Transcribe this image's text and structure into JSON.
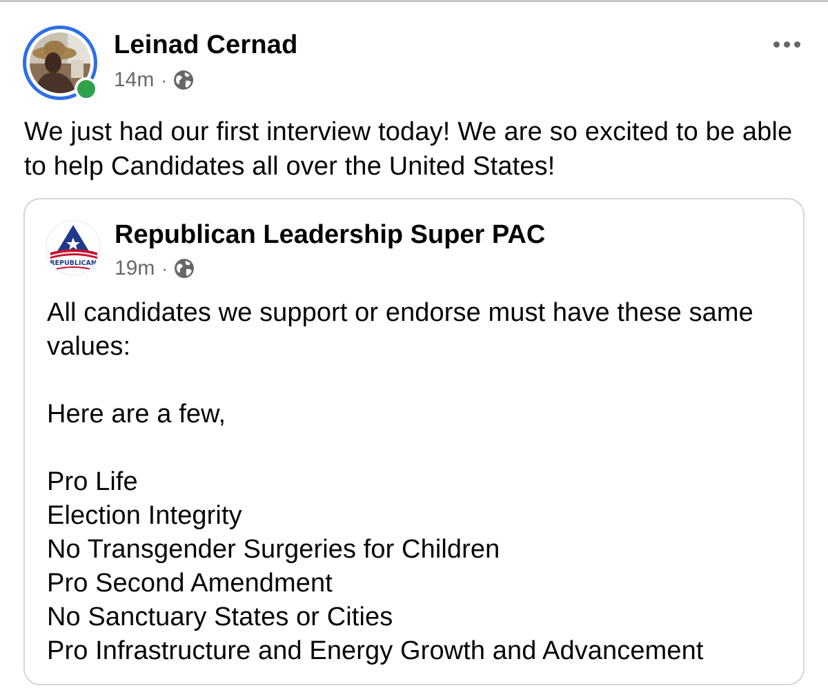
{
  "post": {
    "author_name": "Leinad Cernad",
    "timestamp": "14m",
    "separator": "·",
    "audience_icon": "globe-icon",
    "online_status": "online",
    "more_icon": "more-options-icon",
    "text": "We just had our first interview today! We are so excited to be able to help Candidates all over the United States!"
  },
  "shared_post": {
    "page_name": "Republican Leadership Super PAC",
    "timestamp": "19m",
    "separator": "·",
    "audience_icon": "globe-icon",
    "logo_text": "REPUBLICAN",
    "intro": "All candidates we support or endorse must have these same values:",
    "lead": "Here are a few,",
    "values": [
      "Pro Life",
      "Election Integrity",
      "No Transgender Surgeries for Children",
      "Pro Second Amendment",
      "No Sanctuary States or Cities",
      "Pro Infrastructure and Energy Growth and Advancement"
    ]
  },
  "colors": {
    "story_ring": "#2d6fe6",
    "online_dot": "#31a24c",
    "meta_text": "#65676b",
    "body_text": "#050505",
    "card_border": "#d6d6d6"
  }
}
